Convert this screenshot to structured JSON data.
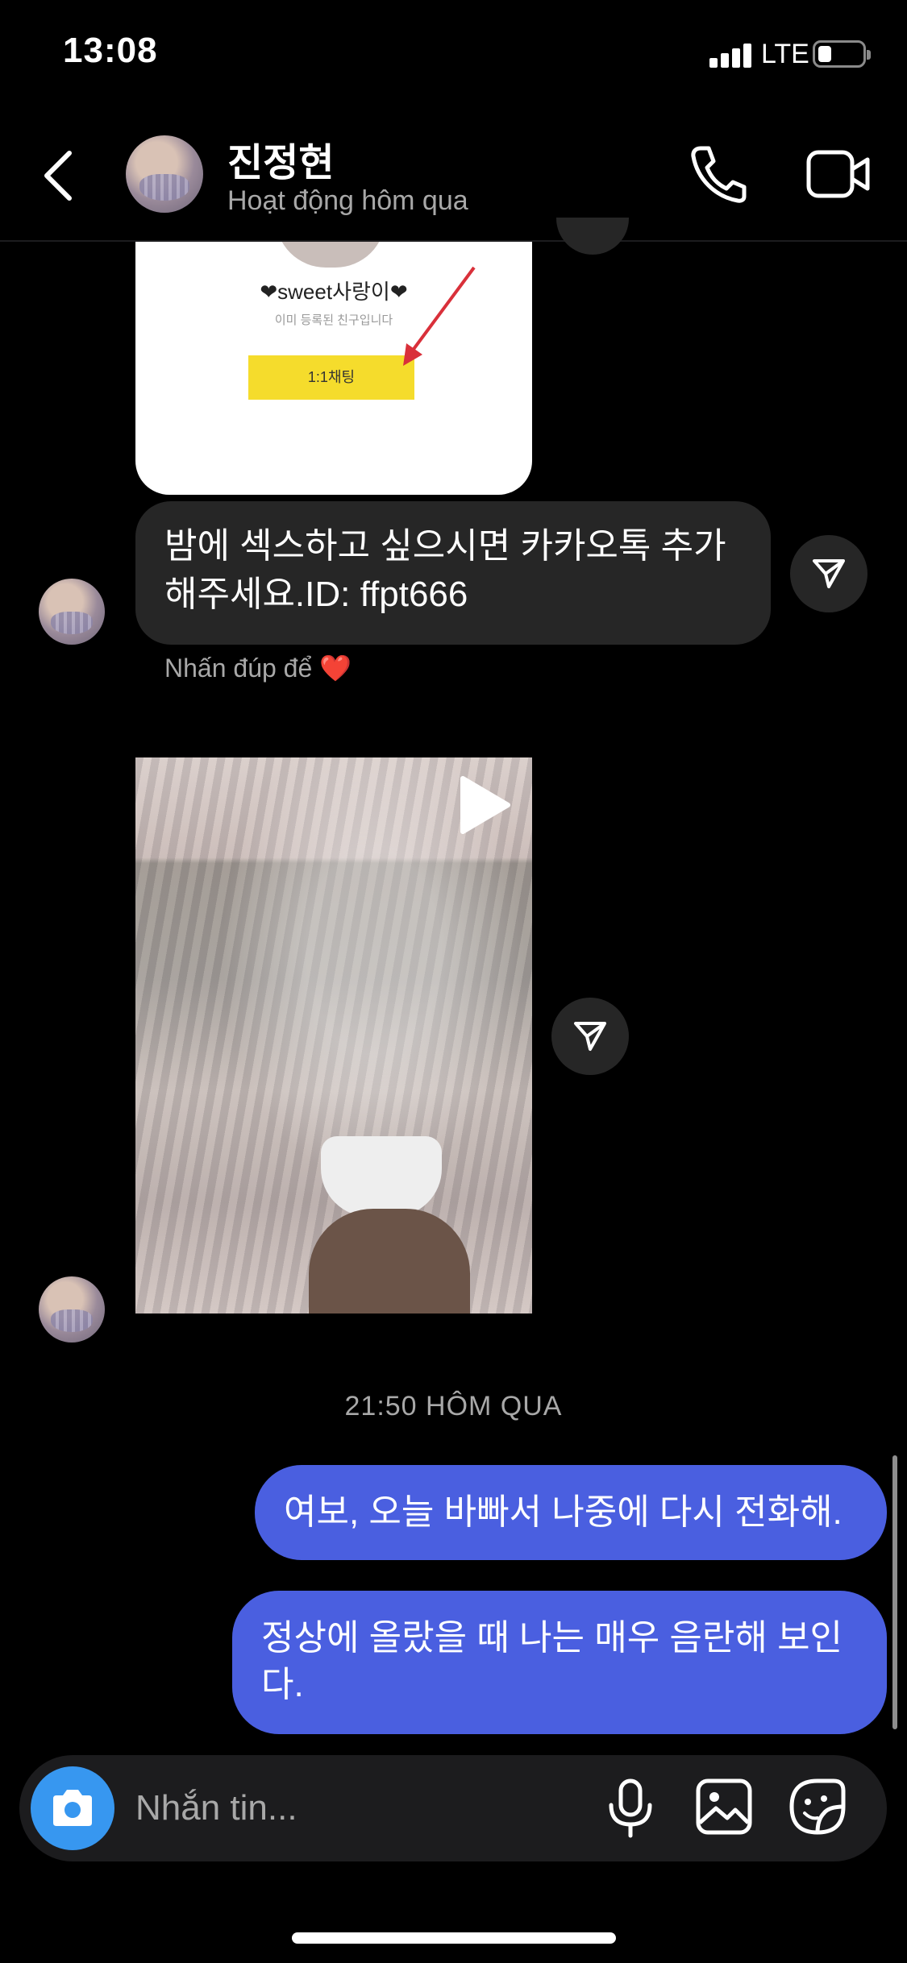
{
  "status_bar": {
    "time": "13:08",
    "network": "LTE",
    "battery_level": 0.3
  },
  "header": {
    "name": "진정현",
    "status": "Hoạt động hôm qua",
    "back_icon": "chevron-left-icon",
    "call_icon": "phone-icon",
    "video_icon": "video-camera-icon"
  },
  "messages": {
    "image_card": {
      "title": "❤sweet사랑이❤",
      "subtitle": "이미 등록된 친구입니다",
      "button_label": "1:1채팅"
    },
    "received_text": "밤에 섹스하고 싶으시면 카카오톡 추가 해주세요.ID:   ffpt666",
    "double_tap_hint": "Nhấn đúp để",
    "heart_glyph": "❤️",
    "timestamp": "21:50 HÔM QUA",
    "sent_1": "여보, 오늘 바빠서 나중에 다시 전화해.",
    "sent_2": "정상에 올랐을 때 나는 매우 음란해 보인다."
  },
  "composer": {
    "placeholder": "Nhắn tin...",
    "camera_icon": "camera-icon",
    "mic_icon": "microphone-icon",
    "gallery_icon": "image-icon",
    "sticker_icon": "sticker-icon"
  },
  "colors": {
    "background": "#000000",
    "received_bubble": "#262626",
    "sent_bubble": "#4a5fe0",
    "camera_button": "#3797f0",
    "muted_text": "#a8a8a8"
  }
}
